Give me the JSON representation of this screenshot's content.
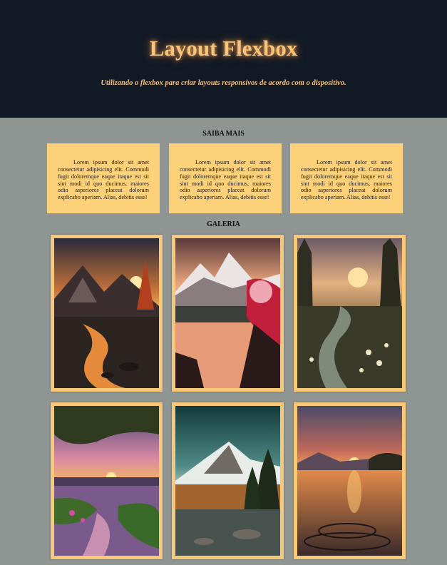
{
  "header": {
    "title": "Layout Flexbox",
    "subtitle": "Utilizando o flexbox para criar layouts responsivos de acordo com o dispositivo."
  },
  "saiba_mais": {
    "heading": "SAIBA MAIS",
    "boxes": [
      {
        "text": "Lorem ipsum dolor sit amet consectetur adipisicing elit. Commodi fugit doloremque eaque itaque est sit sint modi id quo ducimus, maiores odio asperiores placeat dolorum explicabo aperiam. Alias, debitis esse!"
      },
      {
        "text": "Lorem ipsum dolor sit amet consectetur adipisicing elit. Commodi fugit doloremque eaque itaque est sit sint modi id quo ducimus, maiores odio asperiores placeat dolorum explicabo aperiam. Alias, debitis esse!"
      },
      {
        "text": "Lorem ipsum dolor sit amet consectetur adipisicing elit. Commodi fugit doloremque eaque itaque est sit sint modi id quo ducimus, maiores odio asperiores placeat dolorum explicabo aperiam. Alias, debitis esse!"
      }
    ]
  },
  "galeria": {
    "heading": "GALERIA"
  },
  "colors": {
    "header_bg": "#121a26",
    "page_bg": "#8f9592",
    "accent": "#f7c27a",
    "box_bg": "#fdd07a"
  }
}
